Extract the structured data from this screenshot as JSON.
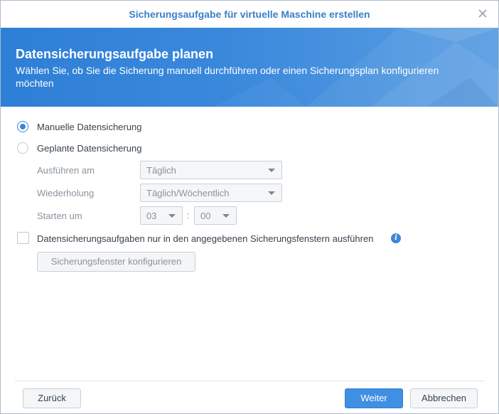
{
  "window": {
    "title": "Sicherungsaufgabe für virtuelle Maschine erstellen"
  },
  "banner": {
    "heading": "Datensicherungsaufgabe planen",
    "subheading": "Wählen Sie, ob Sie die Sicherung manuell durchführen oder einen Sicherungsplan konfigurieren möchten"
  },
  "options": {
    "manual_label": "Manuelle Datensicherung",
    "manual_selected": true,
    "scheduled_label": "Geplante Datensicherung",
    "scheduled_selected": false
  },
  "schedule": {
    "run_on_label": "Ausführen am",
    "run_on_value": "Täglich",
    "repeat_label": "Wiederholung",
    "repeat_value": "Täglich/Wöchentlich",
    "start_label": "Starten um",
    "start_hour": "03",
    "time_separator": ":",
    "start_minute": "00"
  },
  "window_option": {
    "checkbox_label": "Datensicherungsaufgaben nur in den angegebenen Sicherungsfenstern ausführen",
    "checked": false,
    "info_glyph": "i",
    "configure_button": "Sicherungsfenster konfigurieren"
  },
  "footer": {
    "back_button": "Zurück",
    "next_button": "Weiter",
    "cancel_button": "Abbrechen"
  },
  "colors": {
    "accent": "#3d86d8",
    "title_text": "#3a7fc4",
    "banner_start": "#2d7fd6",
    "banner_end": "#5a9ee2",
    "primary_button": "#3f8fe2"
  },
  "icons": {
    "close": "close-icon",
    "info": "info-icon",
    "dropdown": "chevron-down-icon"
  }
}
